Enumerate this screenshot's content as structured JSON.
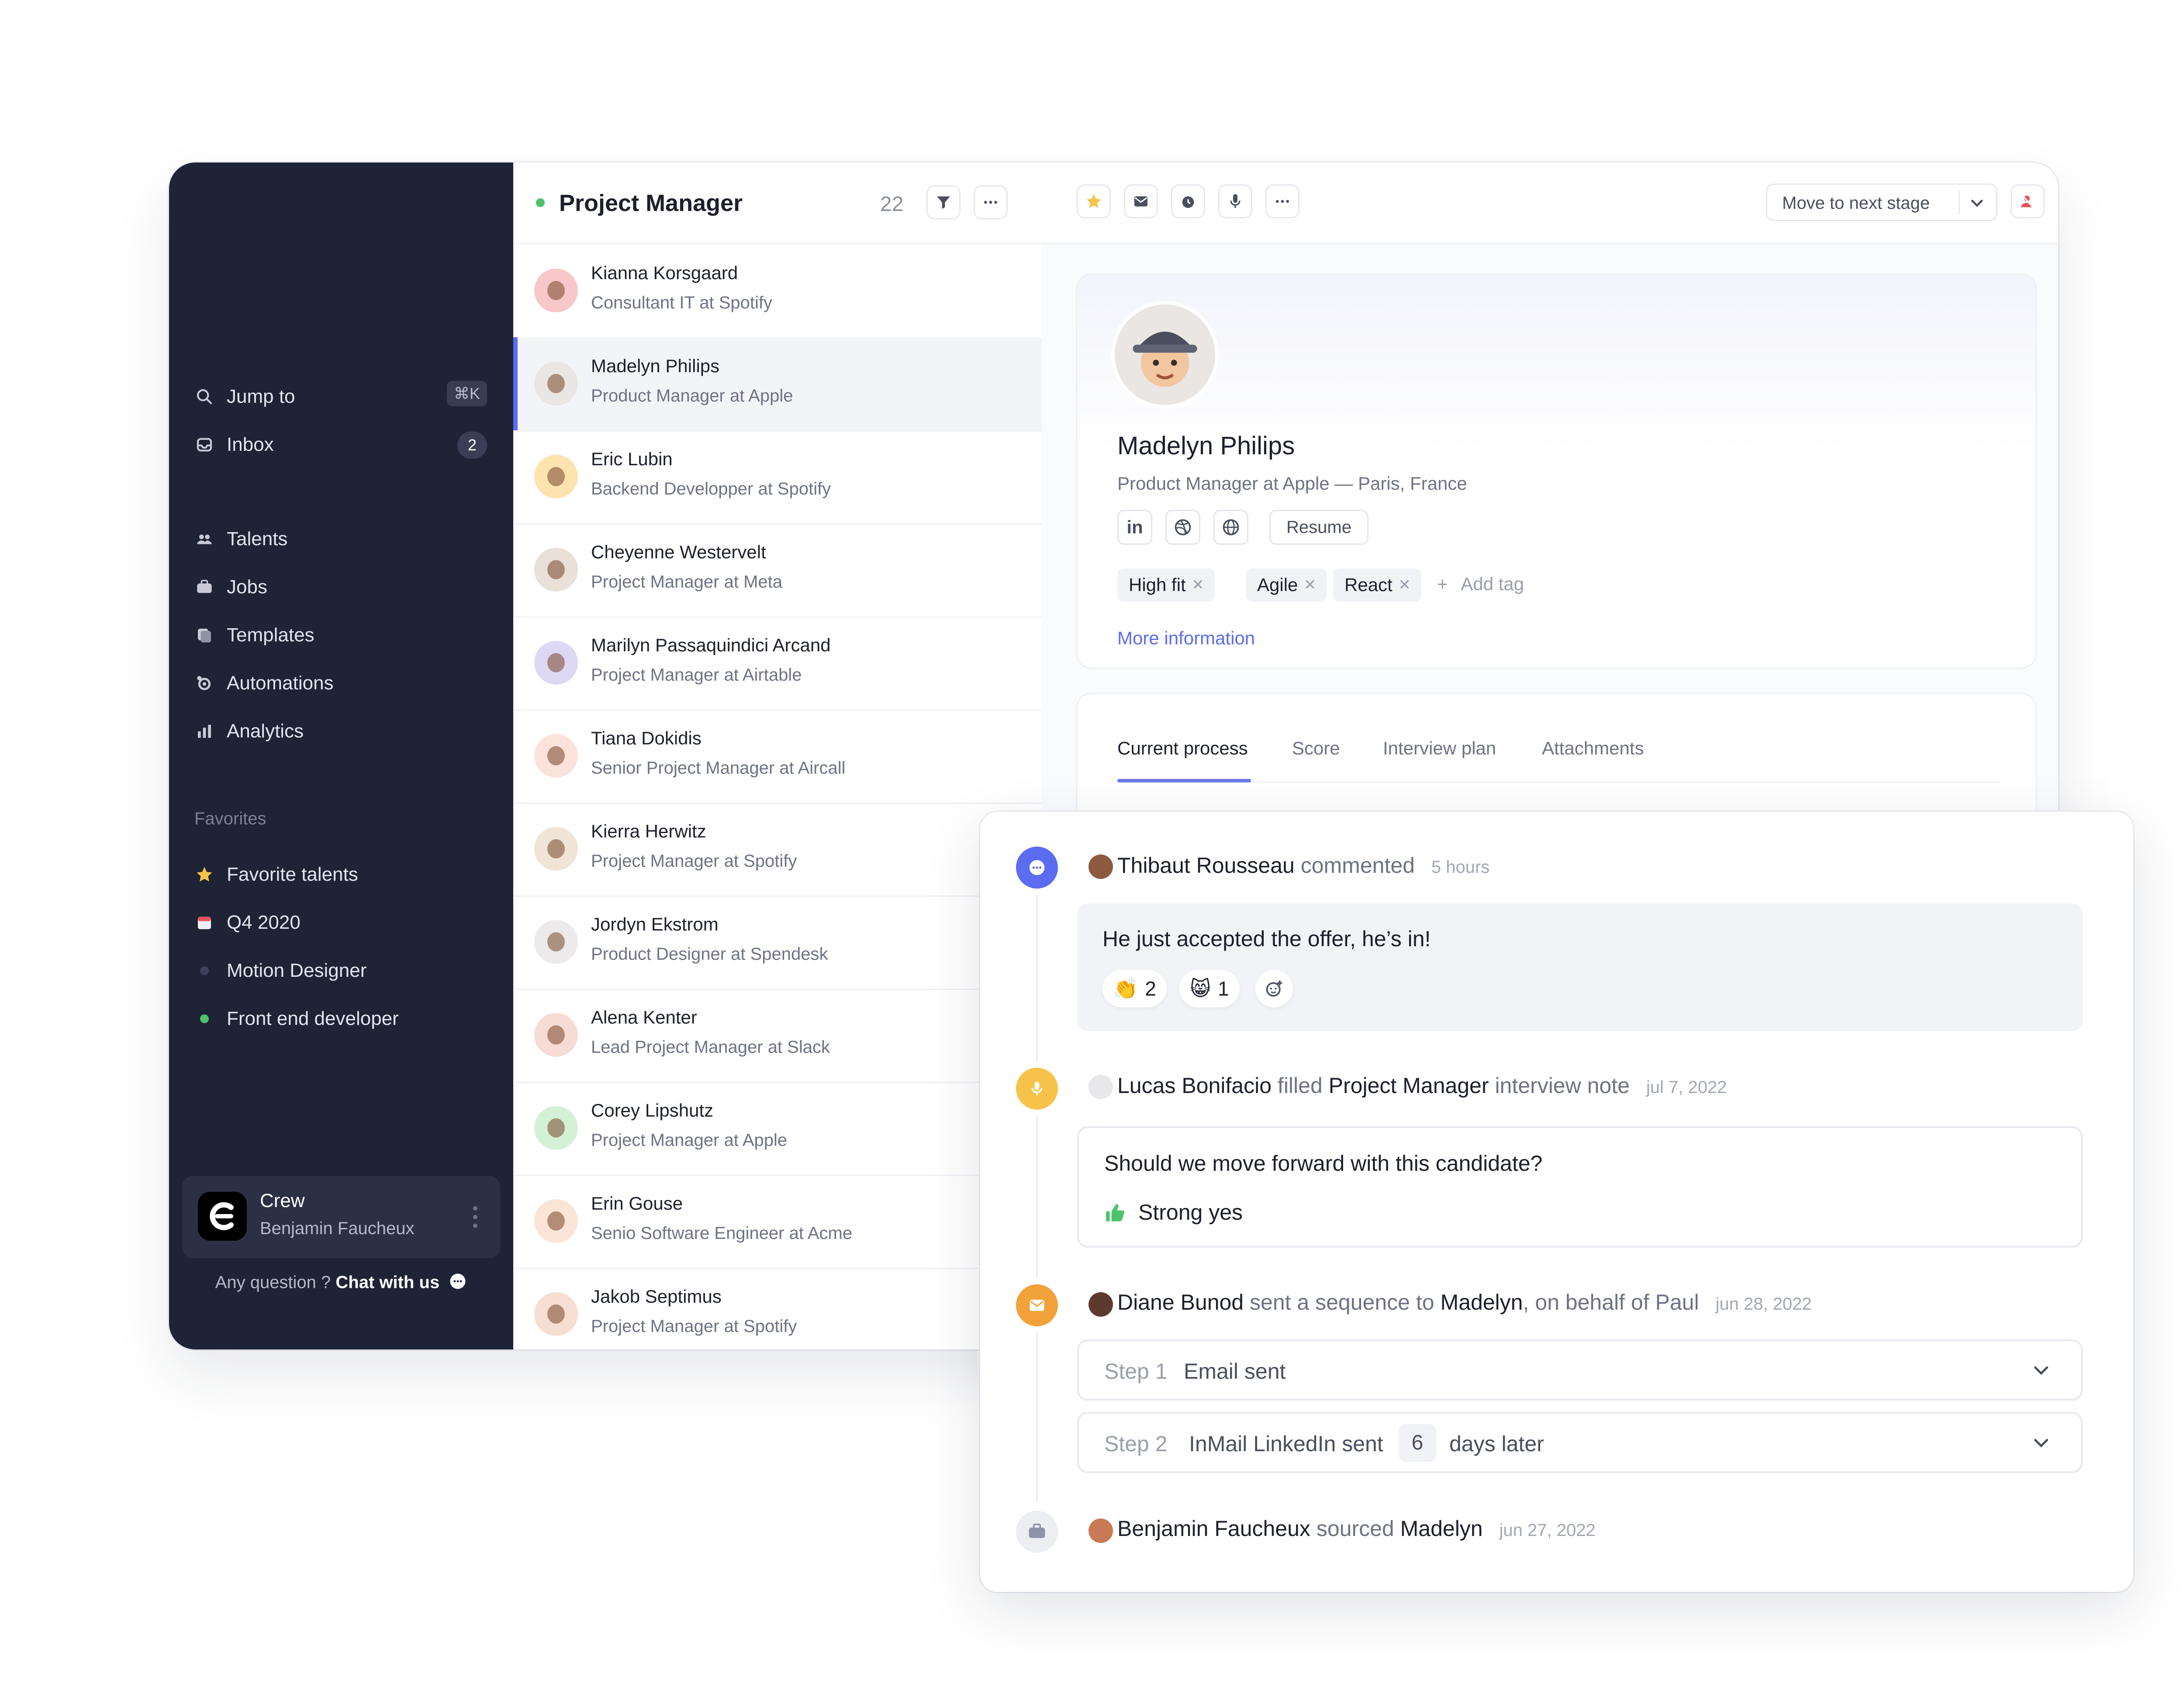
{
  "sidebar": {
    "jump": {
      "label": "Jump to",
      "shortcut": "⌘K"
    },
    "inbox": {
      "label": "Inbox",
      "count": "2"
    },
    "nav": [
      "Talents",
      "Jobs",
      "Templates",
      "Automations",
      "Analytics"
    ],
    "favorites_heading": "Favorites",
    "favorites": [
      "Favorite talents",
      "Q4 2020",
      "Motion Designer",
      "Front end developer"
    ],
    "workspace": {
      "name": "Crew",
      "user": "Benjamin Faucheux"
    },
    "help": {
      "question": "Any question ?",
      "link": "Chat with us"
    }
  },
  "list": {
    "title": "Project Manager",
    "count": "22",
    "candidates": [
      {
        "name": "Kianna Korsgaard",
        "role": "Consultant IT at Spotify",
        "color": "#f8c7c9"
      },
      {
        "name": "Madelyn Philips",
        "role": "Product Manager at Apple",
        "color": "#e9e6e3"
      },
      {
        "name": "Eric Lubin",
        "role": "Backend Developper at Spotify",
        "color": "#fde3b0"
      },
      {
        "name": "Cheyenne Westervelt",
        "role": "Project Manager at Meta",
        "color": "#e9e1d8"
      },
      {
        "name": "Marilyn Passaquindici Arcand",
        "role": "Project Manager at Airtable",
        "color": "#ddd8f4"
      },
      {
        "name": "Tiana Dokidis",
        "role": "Senior Project Manager at Aircall",
        "color": "#fbe3dc"
      },
      {
        "name": "Kierra Herwitz",
        "role": "Project Manager at Spotify",
        "color": "#efe4d6"
      },
      {
        "name": "Jordyn Ekstrom",
        "role": "Product Designer at Spendesk",
        "color": "#eceaea"
      },
      {
        "name": "Alena Kenter",
        "role": "Lead Project Manager at Slack",
        "color": "#f6dcd4"
      },
      {
        "name": "Corey Lipshutz",
        "role": "Project Manager at Apple",
        "color": "#d3f1d7"
      },
      {
        "name": "Erin Gouse",
        "role": "Senio Software Engineer at Acme",
        "color": "#fbe5d6"
      },
      {
        "name": "Jakob Septimus",
        "role": "Project Manager at Spotify",
        "color": "#f7ded3"
      }
    ]
  },
  "detail": {
    "move_stage": "Move to next stage",
    "profile": {
      "name": "Madelyn Philips",
      "subtitle": "Product Manager at Apple — Paris, France",
      "resume": "Resume",
      "tags": [
        "High fit",
        "Agile",
        "React"
      ],
      "add_tag": "Add tag",
      "more_info": "More information"
    },
    "tabs": [
      "Current process",
      "Score",
      "Interview plan",
      "Attachments"
    ]
  },
  "activity": {
    "comment": {
      "author": "Thibaut Rousseau",
      "verb": "commented",
      "time": "5 hours",
      "text": "He just accepted the offer, he’s in!",
      "reactions": [
        {
          "emoji": "👏",
          "count": "2"
        },
        {
          "emoji": "😸",
          "count": "1"
        }
      ]
    },
    "note": {
      "author": "Lucas Bonifacio",
      "verb": "filled",
      "target": "Project Manager",
      "suffix": "interview note",
      "time": "jul 7, 2022",
      "question": "Should we move forward with this candidate?",
      "answer": "Strong yes"
    },
    "sequence": {
      "author": "Diane Bunod",
      "verb": "sent a sequence to",
      "target": "Madelyn",
      "suffix": ", on behalf of Paul",
      "time": "jun 28, 2022",
      "step1": {
        "label": "Step 1",
        "text": "Email sent"
      },
      "step2": {
        "label": "Step 2",
        "text": "InMail LinkedIn sent",
        "num": "6",
        "suffix": "days later"
      }
    },
    "sourced": {
      "author": "Benjamin Faucheux",
      "verb": "sourced",
      "target": "Madelyn",
      "time": "jun 27, 2022"
    }
  },
  "colors": {
    "accent": "#5b6cf0",
    "sidebar": "#1f2336",
    "green": "#4cc26a",
    "yellow": "#f8c34a",
    "orange": "#f2a13b"
  }
}
